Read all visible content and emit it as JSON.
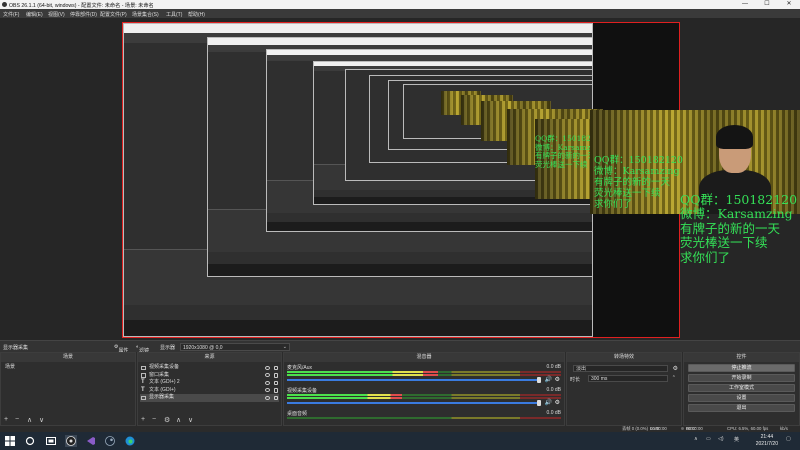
{
  "window": {
    "title": "OBS 26.1.1 (64-bit, windows) - 配置文件: 未命名 - 场景: 未命名",
    "controls": [
      "—",
      "☐",
      "✕"
    ]
  },
  "menu": [
    "文件(F)",
    "编辑(E)",
    "视图(V)",
    "停靠部件(D)",
    "配置文件(P)",
    "场景集合(S)",
    "工具(T)",
    "帮助(H)"
  ],
  "preview": {
    "overlay_lines": [
      "QQ群：150182120",
      "微博：Karsamzing",
      "有牌子的新的一天",
      "荧光棒送一下续",
      "求你们了"
    ]
  },
  "source_toolbar": {
    "dock_title": "显示器采集",
    "properties_label": "属性",
    "filters_label": "滤镜",
    "display_label": "显示器",
    "display_value": "1920x1080 @ 0,0"
  },
  "scenes": {
    "title": "场景",
    "items": [
      "场景"
    ],
    "footer": [
      "+",
      "−",
      "∧",
      "∨"
    ]
  },
  "sources": {
    "title": "来源",
    "items": [
      "视频采集设备",
      "窗口采集",
      "文本 (GDI+) 2",
      "文本 (GDI+)",
      "显示器采集"
    ],
    "footer": [
      "+",
      "−",
      "⚙",
      "∧",
      "∨"
    ]
  },
  "mixer": {
    "title": "混音器",
    "channels": [
      {
        "name": "麦克风/Aux",
        "db": "0.0 dB",
        "level": 0.55,
        "volume": 1.0
      },
      {
        "name": "视频采集设备",
        "db": "0.0 dB",
        "level": 0.42,
        "volume": 1.0
      },
      {
        "name": "桌面音频",
        "db": "0.0 dB",
        "level": 0.0,
        "volume": 1.0
      }
    ]
  },
  "transitions": {
    "title": "转场特效",
    "type": "淡出",
    "duration_label": "时长",
    "duration_value": "300 ms"
  },
  "controls": {
    "title": "控件",
    "buttons": [
      {
        "label": "停止推流",
        "active": true
      },
      {
        "label": "开始录制",
        "active": false
      },
      {
        "label": "工作室模式",
        "active": false
      },
      {
        "label": "设置",
        "active": false
      },
      {
        "label": "退出",
        "active": false
      }
    ]
  },
  "status": {
    "live_label": "LIVE:",
    "live_time": "00:00:00",
    "rec_label": "REC:",
    "rec_time": "00:00:00",
    "cpu": "CPU: 6.5%, 60.00 fps",
    "extra": "kb/s",
    "dropped": "丢帧 0 (0.0%)"
  },
  "taskbar": {
    "time": "21:44",
    "date": "2021/7/20",
    "ime": "英"
  }
}
